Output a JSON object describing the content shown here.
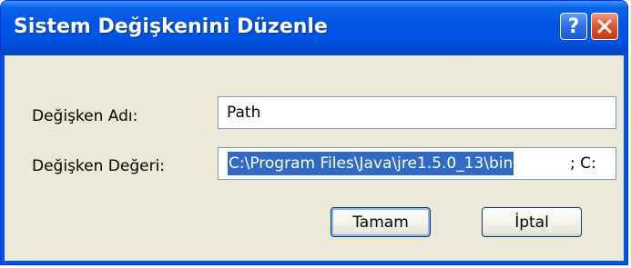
{
  "window": {
    "title": "Sistem Değişkenini Düzenle",
    "help_glyph": "?",
    "close_icon": "close-x-icon"
  },
  "form": {
    "name_label": "Değişken Adı:",
    "name_value": "Path",
    "value_label": "Değişken Değeri:",
    "value_selected": "C:\\Program Files\\Java\\jre1.5.0_13\\bin",
    "value_rest": "; C:"
  },
  "buttons": {
    "ok_label": "Tamam",
    "cancel_label": "İptal"
  },
  "colors": {
    "titlebar": "#0054e3",
    "dialog_background": "#ece9d8",
    "selection": "#316ac5",
    "close_button": "#e1582f"
  }
}
